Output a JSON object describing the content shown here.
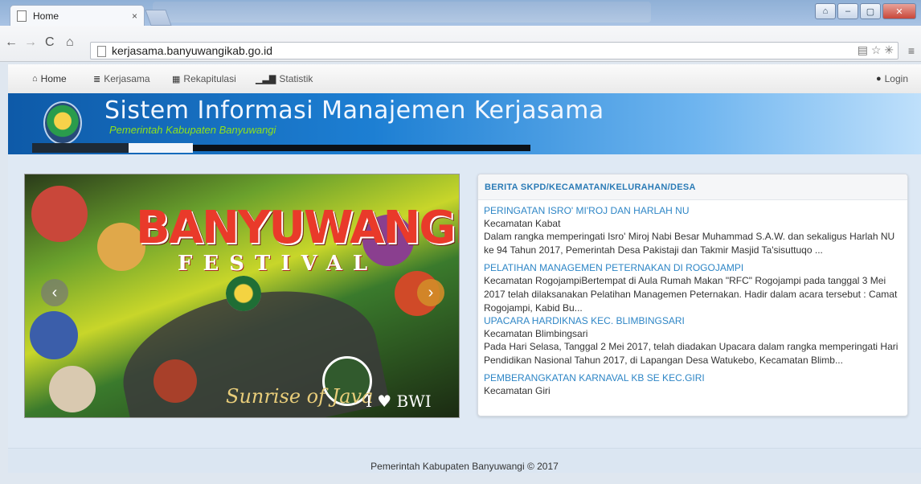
{
  "browser": {
    "tab_title": "Home",
    "tab_close": "×",
    "url": "kerjasama.banyuwangikab.go.id",
    "window_buttons": [
      "⌂",
      "–",
      "▢",
      "✕"
    ]
  },
  "nav": {
    "home": "Home",
    "kerjasama": "Kerjasama",
    "rekapitulasi": "Rekapitulasi",
    "statistik": "Statistik",
    "login": "Login"
  },
  "header": {
    "title": "Sistem Informasi Manajemen Kerjasama",
    "subtitle": "Pemerintah Kabupaten Banyuwangi"
  },
  "slider": {
    "brand": "BANYUWANGI",
    "festival": "FESTIVAL",
    "sunrise": "Sunrise of Java",
    "tagline": "I ♥ BWI",
    "prev": "‹",
    "next": "›"
  },
  "news": {
    "heading": "BERITA SKPD/KECAMATAN/KELURAHAN/DESA",
    "items": [
      {
        "title": "PERINGATAN ISRO' MI'ROJ DAN HARLAH NU",
        "location": "Kecamatan Kabat",
        "body": "Dalam rangka memperingati Isro' Miroj Nabi Besar Muhammad S.A.W. dan sekaligus Harlah NU ke 94 Tahun 2017, Pemerintah Desa Pakistaji dan Takmir Masjid Ta'sisuttuqo ..."
      },
      {
        "title": "PELATIHAN MANAGEMEN PETERNAKAN DI ROGOJAMPI",
        "location": "",
        "body": "Kecamatan RogojampiBertempat di Aula Rumah Makan \"RFC\" Rogojampi pada tanggal 3 Mei 2017 telah dilaksanakan Pelatihan Managemen Peternakan. Hadir dalam acara tersebut : Camat Rogojampi, Kabid Bu..."
      },
      {
        "title": "UPACARA HARDIKNAS KEC. BLIMBINGSARI",
        "location": "Kecamatan Blimbingsari",
        "body": "Pada Hari Selasa, Tanggal 2 Mei 2017, telah diadakan Upacara dalam rangka memperingati Hari Pendidikan Nasional Tahun 2017, di Lapangan Desa Watukebo,  Kecamatan Blimb..."
      },
      {
        "title": "PEMBERANGKATAN KARNAVAL KB SE KEC.GIRI",
        "location": "Kecamatan Giri",
        "body": ""
      }
    ]
  },
  "footer": {
    "text": "Pemerintah Kabupaten Banyuwangi © 2017"
  }
}
